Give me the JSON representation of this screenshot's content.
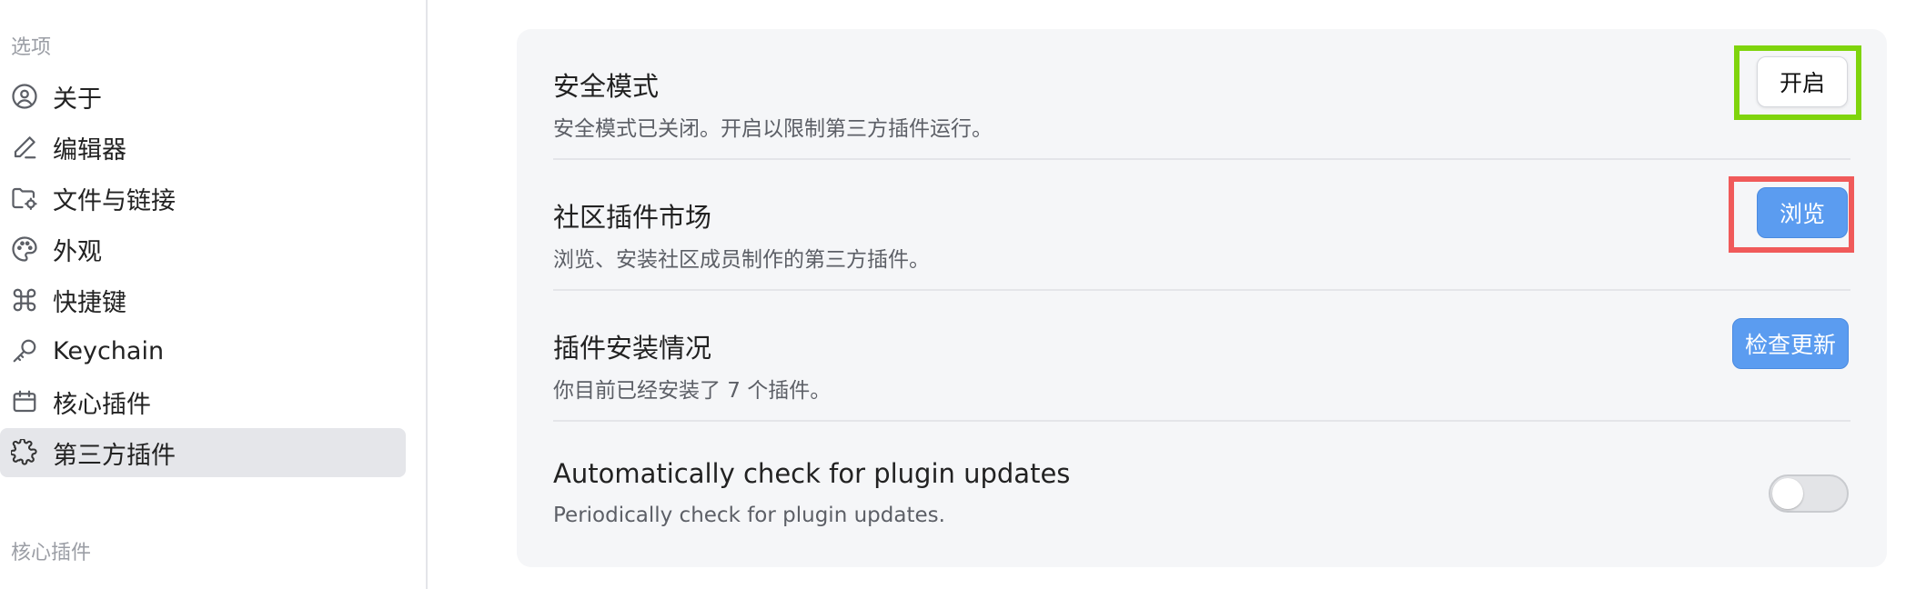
{
  "sidebar": {
    "section_options": "选项",
    "section_core_plugins": "核心插件",
    "items": [
      {
        "label": "关于",
        "icon": "user-circle-icon"
      },
      {
        "label": "编辑器",
        "icon": "pencil-icon"
      },
      {
        "label": "文件与链接",
        "icon": "folder-cog-icon"
      },
      {
        "label": "外观",
        "icon": "palette-icon"
      },
      {
        "label": "快捷键",
        "icon": "command-icon"
      },
      {
        "label": "Keychain",
        "icon": "key-icon"
      },
      {
        "label": "核心插件",
        "icon": "calendar-box-icon"
      },
      {
        "label": "第三方插件",
        "icon": "puzzle-icon",
        "active": true
      }
    ]
  },
  "settings": {
    "safe_mode": {
      "title": "安全模式",
      "description": "安全模式已关闭。开启以限制第三方插件运行。",
      "button": "开启"
    },
    "community_market": {
      "title": "社区插件市场",
      "description": "浏览、安装社区成员制作的第三方插件。",
      "button": "浏览"
    },
    "installed": {
      "title": "插件安装情况",
      "description": "你目前已经安装了 7 个插件。",
      "button": "检查更新"
    },
    "auto_update": {
      "title": "Automatically check for plugin updates",
      "description": "Periodically check for plugin updates.",
      "enabled": false
    }
  },
  "colors": {
    "accent_blue": "#5b9cf0",
    "highlight_green": "#7fd40c",
    "highlight_red": "#f05a5a"
  }
}
